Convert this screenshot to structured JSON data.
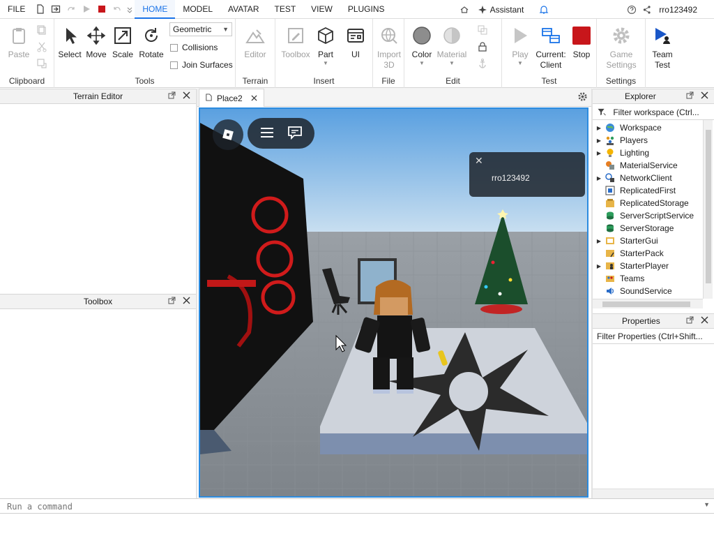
{
  "menubar": {
    "file": "FILE",
    "tabs": [
      "HOME",
      "MODEL",
      "AVATAR",
      "TEST",
      "VIEW",
      "PLUGINS"
    ],
    "active_tab": "HOME",
    "assistant": "Assistant",
    "username": "rro123492"
  },
  "ribbon": {
    "clipboard": {
      "label": "Clipboard",
      "paste": "Paste"
    },
    "tools": {
      "label": "Tools",
      "select": "Select",
      "move": "Move",
      "scale": "Scale",
      "rotate": "Rotate",
      "mode_value": "Geometric",
      "collisions": "Collisions",
      "join_surfaces": "Join Surfaces"
    },
    "terrain": {
      "label": "Terrain",
      "editor": "Editor"
    },
    "insert": {
      "label": "Insert",
      "toolbox": "Toolbox",
      "part": "Part",
      "ui": "UI"
    },
    "file": {
      "label": "File",
      "import_line1": "Import",
      "import_line2": "3D"
    },
    "edit": {
      "label": "Edit",
      "color": "Color",
      "material": "Material"
    },
    "test": {
      "label": "Test",
      "play": "Play",
      "current_line1": "Current:",
      "current_line2": "Client",
      "stop": "Stop"
    },
    "settings": {
      "label": "Settings",
      "game_line1": "Game",
      "game_line2": "Settings"
    },
    "team": {
      "line1": "Team",
      "line2": "Test"
    }
  },
  "left": {
    "terrain_editor": "Terrain Editor",
    "toolbox": "Toolbox"
  },
  "viewport": {
    "tab_name": "Place2",
    "popup_name": "rro123492"
  },
  "explorer": {
    "title": "Explorer",
    "filter": "Filter workspace (Ctrl...",
    "items": [
      {
        "name": "Workspace",
        "expandable": true,
        "icon": "globe-icon"
      },
      {
        "name": "Players",
        "expandable": true,
        "icon": "players-icon"
      },
      {
        "name": "Lighting",
        "expandable": true,
        "icon": "lightbulb-icon"
      },
      {
        "name": "MaterialService",
        "expandable": false,
        "icon": "material-icon"
      },
      {
        "name": "NetworkClient",
        "expandable": true,
        "icon": "network-icon"
      },
      {
        "name": "ReplicatedFirst",
        "expandable": false,
        "icon": "replicated-first-icon"
      },
      {
        "name": "ReplicatedStorage",
        "expandable": false,
        "icon": "replicated-storage-icon"
      },
      {
        "name": "ServerScriptService",
        "expandable": false,
        "icon": "server-script-icon"
      },
      {
        "name": "ServerStorage",
        "expandable": false,
        "icon": "server-storage-icon"
      },
      {
        "name": "StarterGui",
        "expandable": true,
        "icon": "starter-gui-icon"
      },
      {
        "name": "StarterPack",
        "expandable": false,
        "icon": "starter-pack-icon"
      },
      {
        "name": "StarterPlayer",
        "expandable": true,
        "icon": "starter-player-icon"
      },
      {
        "name": "Teams",
        "expandable": false,
        "icon": "teams-icon"
      },
      {
        "name": "SoundService",
        "expandable": false,
        "icon": "sound-icon"
      }
    ]
  },
  "properties": {
    "title": "Properties",
    "filter": "Filter Properties (Ctrl+Shift..."
  },
  "command": {
    "placeholder": "Run a command"
  },
  "colors": {
    "accent": "#1a73e8",
    "viewport_border": "#2b8be0",
    "stop_red": "#c8161b"
  }
}
